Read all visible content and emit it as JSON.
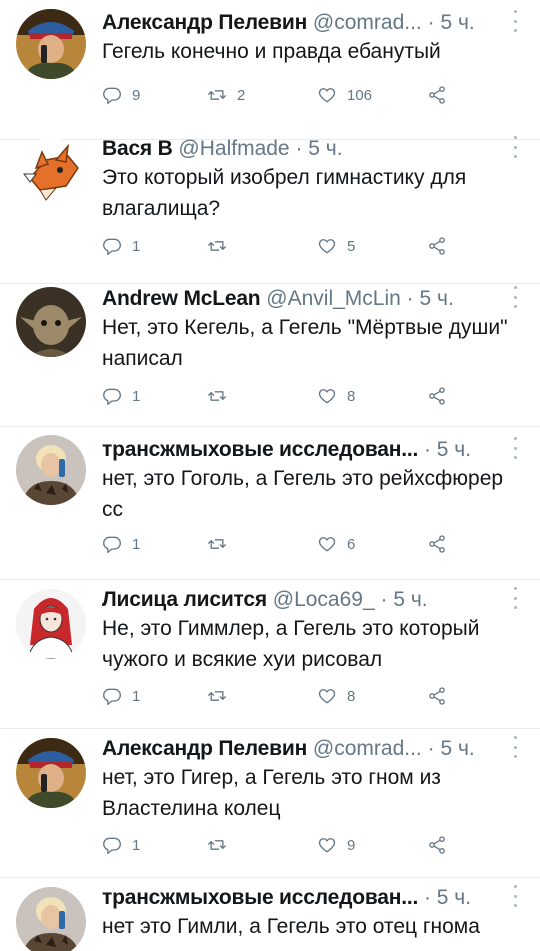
{
  "tweets": [
    {
      "avatar": "military-man-with-phone",
      "name": "Александр Пелевин",
      "handle": "@comrad...",
      "time": "5 ч.",
      "text": "Гегель конечно и правда ебанутый",
      "replies": "9",
      "retweets": "2",
      "likes": "106"
    },
    {
      "avatar": "cartoon-fox",
      "name": "Вася В",
      "handle": "@Halfmade",
      "time": "5 ч.",
      "text": "Это который изобрел гимнастику для влагалища?",
      "replies": "1",
      "retweets": "",
      "likes": "5"
    },
    {
      "avatar": "yoda-creature",
      "name": "Andrew McLean",
      "handle": "@Anvil_McLin",
      "time": "5 ч.",
      "text": "Нет, это Кегель, а Гегель \"Мёртвые души\" написал",
      "replies": "1",
      "retweets": "",
      "likes": "8"
    },
    {
      "avatar": "blonde-woman-with-phone",
      "name": "трансжмыховые исследован...",
      "handle": "",
      "time": "5 ч.",
      "text": "нет, это Гоголь, а Гегель это рейхсфюрер сс",
      "replies": "1",
      "retweets": "",
      "likes": "6"
    },
    {
      "avatar": "red-haired-girl-drawing",
      "name": "Лисица лисится",
      "handle": "@Loca69_",
      "time": "5 ч.",
      "text": "Не, это Гиммлер, а Гегель это который чужого и всякие хуи рисовал",
      "replies": "1",
      "retweets": "",
      "likes": "8"
    },
    {
      "avatar": "military-man-with-phone",
      "name": "Александр Пелевин",
      "handle": "@comrad...",
      "time": "5 ч.",
      "text": "нет, это Гигер, а Гегель это гном из Властелина колец",
      "replies": "1",
      "retweets": "",
      "likes": "9"
    },
    {
      "avatar": "blonde-woman-with-phone",
      "name": "трансжмыховые исследован...",
      "handle": "",
      "time": "5 ч.",
      "text": "нет это Гимли, а Гегель это отец гнома",
      "replies": "",
      "retweets": "",
      "likes": ""
    }
  ],
  "icons": {
    "reply": "reply-icon",
    "retweet": "retweet-icon",
    "like": "heart-icon",
    "share": "share-icon",
    "more": "more-icon"
  },
  "colors": {
    "text": "#14171a",
    "secondary": "#657786",
    "divider": "#e6ecf0"
  }
}
